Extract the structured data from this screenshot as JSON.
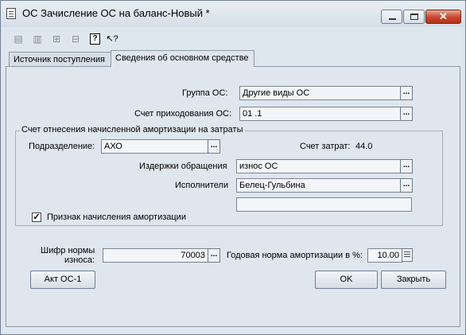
{
  "window": {
    "title": "ОС Зачисление ОС на баланс-Новый *",
    "close_glyph": "✕"
  },
  "toolbar": {
    "icons": [
      "doc-read-icon",
      "doc-write-icon",
      "copy-down-icon",
      "copy-up-icon",
      "help-icon",
      "pointer-help-icon"
    ],
    "help_glyph": "?",
    "pointer_help_glyph": "↖?"
  },
  "tabs": [
    {
      "label": "Источник поступления",
      "active": false
    },
    {
      "label": "Сведения об основном средстве",
      "active": true
    }
  ],
  "form": {
    "group_os_label": "Группа ОС:",
    "group_os_value": "Другие виды ОС",
    "account_label": "Счет приходования ОС:",
    "account_value": "01 .1",
    "amort_group_title": "Счет отнесения начисленной амортизации на затраты",
    "division_label": "Подразделение:",
    "division_value": "АХО",
    "cost_account_label": "Счет затрат:",
    "cost_account_value": "44.0",
    "expenses_label": "Издержки обращения",
    "expenses_value": "износ ОС",
    "executors_label": "Исполнители",
    "executors_value": "Белец-Гульбина",
    "extra_value": "",
    "amort_checkbox_label": "Признак начисления амортизации",
    "amort_checked": true,
    "checkmark": "✓",
    "wear_code_label_1": "Шифр нормы",
    "wear_code_label_2": "износа:",
    "wear_code_value": "70003",
    "annual_rate_label": "Годовая норма амортизации в %:",
    "annual_rate_value": "10.00",
    "ellipsis": "..."
  },
  "buttons": {
    "act_label": "Акт ОС-1",
    "ok_label": "OK",
    "close_label": "Закрыть"
  },
  "colors": {
    "window_bg": "#dee6ee",
    "close_button": "#c7452c"
  }
}
